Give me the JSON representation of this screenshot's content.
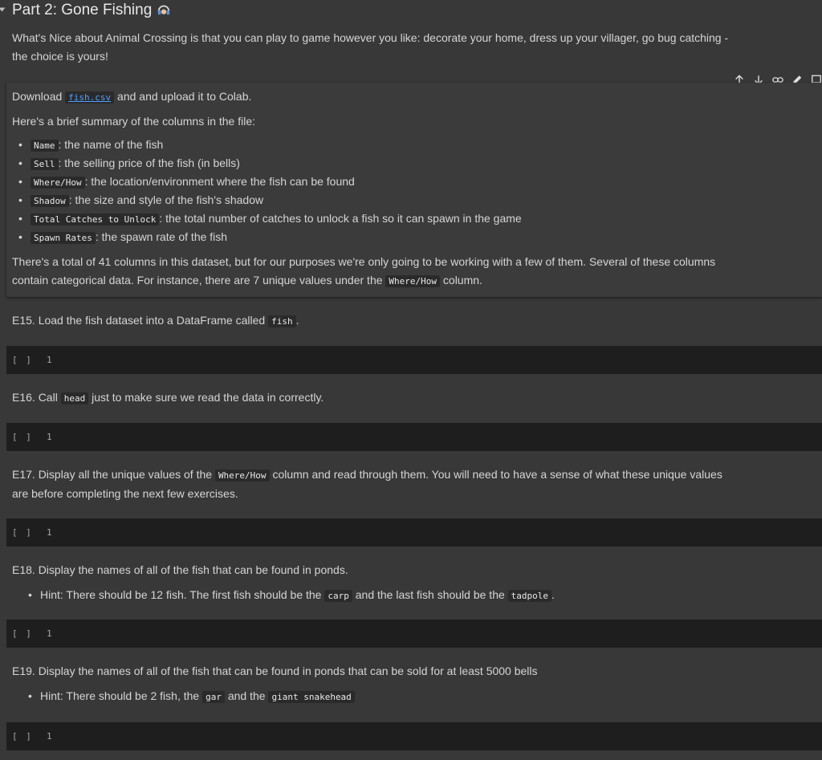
{
  "heading": {
    "title": "Part 2: Gone Fishing"
  },
  "intro": {
    "line1": "What's Nice about Animal Crossing is that you can play to game however you like: decorate your home, dress up your villager, go bug catching -",
    "line2": "the choice is yours!"
  },
  "markdown_cell": {
    "download_prefix": "Download",
    "file_link": "fish.csv",
    "download_suffix": "and and upload it to Colab.",
    "summary_intro": "Here's a brief summary of the columns in the file:",
    "columns": [
      {
        "code": "Name",
        "desc": ": the name of the fish"
      },
      {
        "code": "Sell",
        "desc": ": the selling price of the fish (in bells)"
      },
      {
        "code": "Where/How",
        "desc": ": the location/environment where the fish can be found"
      },
      {
        "code": "Shadow",
        "desc": ": the size and style of the fish's shadow"
      },
      {
        "code": "Total Catches to Unlock",
        "desc": ": the total number of catches to unlock a fish so it can spawn in the game"
      },
      {
        "code": "Spawn Rates",
        "desc": ": the spawn rate of the fish"
      }
    ],
    "outro_line1": "There's a total of 41 columns in this dataset, but for our purposes we're only going to be working with a few of them. Several of these columns",
    "outro_line2_prefix": "contain categorical data. For instance, there are 7 unique values under the",
    "outro_code": "Where/How",
    "outro_line2_suffix": "column."
  },
  "toolbar": {
    "icons": [
      "arrow-up-icon",
      "arrow-down-icon",
      "link-icon",
      "edit-icon",
      "comment-icon"
    ]
  },
  "exercises": {
    "e15": {
      "prefix": "E15. Load the fish dataset into a DataFrame called",
      "code": "fish",
      "suffix": "."
    },
    "e16": {
      "prefix": "E16. Call",
      "code": "head",
      "suffix": "just to make sure we read the data in correctly."
    },
    "e17": {
      "prefix": "E17. Display all the unique values of the",
      "code": "Where/How",
      "suffix": "column and read through them. You will need to have a sense of what these unique values",
      "line2": "are before completing the next few exercises."
    },
    "e18": {
      "text": "E18. Display the names of all of the fish that can be found in ponds.",
      "hint_prefix": "Hint: There should be 12 fish. The first fish should be the",
      "hint_code1": "carp",
      "hint_mid": "and the last fish should be the",
      "hint_code2": "tadpole",
      "hint_suffix": "."
    },
    "e19": {
      "text": "E19. Display the names of all of the fish that can be found in ponds that can be sold for at least 5000 bells",
      "hint_prefix": "Hint: There should be 2 fish, the",
      "hint_code1": "gar",
      "hint_mid": "and the",
      "hint_code2": "giant snakehead"
    }
  },
  "code_cells": {
    "run_bracket": "[ ]",
    "line_number": "1"
  }
}
